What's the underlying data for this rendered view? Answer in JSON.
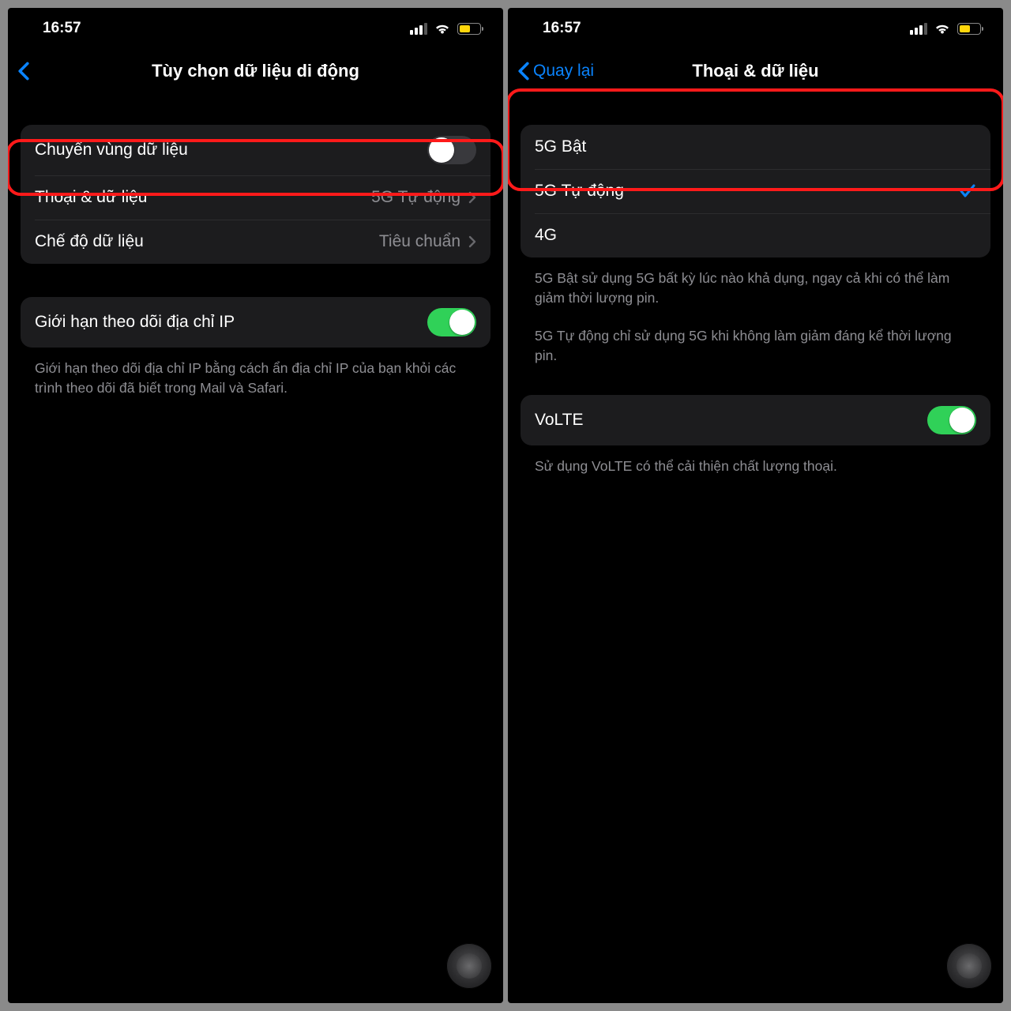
{
  "status": {
    "time": "16:57",
    "battery_pct": 45
  },
  "left": {
    "back_label": "",
    "title": "Tùy chọn dữ liệu di động",
    "roaming": {
      "label": "Chuyển vùng dữ liệu",
      "on": false
    },
    "voice_data": {
      "label": "Thoại & dữ liệu",
      "value": "5G Tự động"
    },
    "data_mode": {
      "label": "Chế độ dữ liệu",
      "value": "Tiêu chuẩn"
    },
    "ip_track": {
      "label": "Giới hạn theo dõi địa chỉ IP",
      "on": true,
      "footer": "Giới hạn theo dõi địa chỉ IP bằng cách ẩn địa chỉ IP của bạn khỏi các trình theo dõi đã biết trong Mail và Safari."
    }
  },
  "right": {
    "back_label": "Quay lại",
    "title": "Thoại & dữ liệu",
    "options": [
      {
        "label": "5G Bật",
        "selected": false
      },
      {
        "label": "5G Tự động",
        "selected": true
      },
      {
        "label": "4G",
        "selected": false
      }
    ],
    "footer1": "5G Bật sử dụng 5G bất kỳ lúc nào khả dụng, ngay cả khi có thể làm giảm thời lượng pin.",
    "footer2": "5G Tự động chỉ sử dụng 5G khi không làm giảm đáng kể thời lượng pin.",
    "volte": {
      "label": "VoLTE",
      "on": true,
      "footer": "Sử dụng VoLTE có thể cải thiện chất lượng thoại."
    }
  },
  "colors": {
    "accent": "#0a84ff",
    "green": "#30d158",
    "highlight": "#ff1a1a"
  }
}
